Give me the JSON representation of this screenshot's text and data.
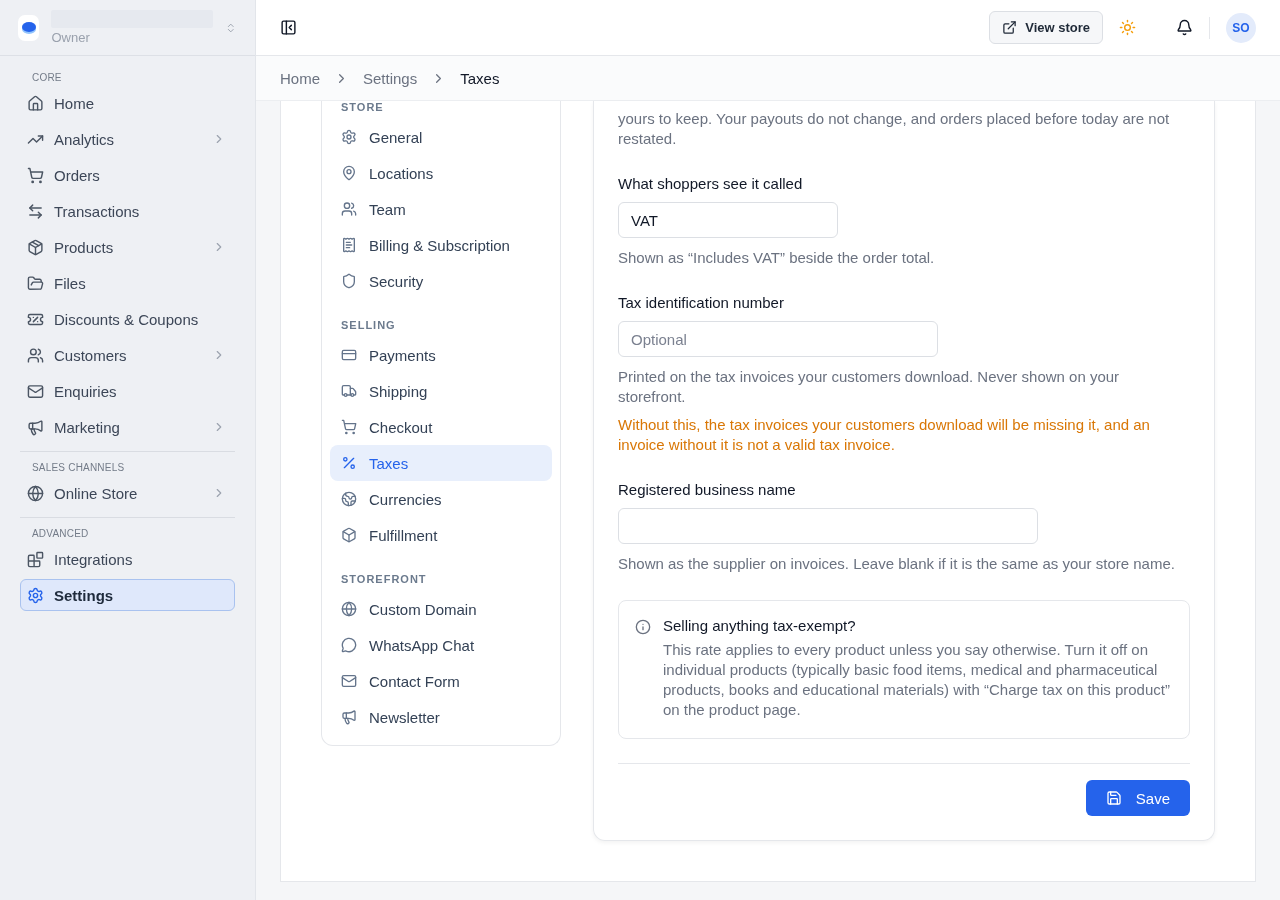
{
  "sidebar": {
    "account": {
      "role": "Owner"
    },
    "sections": [
      {
        "title": "CORE",
        "items": [
          {
            "label": "Home",
            "expandable": false,
            "selected": false
          },
          {
            "label": "Analytics",
            "expandable": true,
            "selected": false
          },
          {
            "label": "Orders",
            "expandable": false,
            "selected": false
          },
          {
            "label": "Transactions",
            "expandable": false,
            "selected": false
          },
          {
            "label": "Products",
            "expandable": true,
            "selected": false
          },
          {
            "label": "Files",
            "expandable": false,
            "selected": false
          },
          {
            "label": "Discounts & Coupons",
            "expandable": false,
            "selected": false
          },
          {
            "label": "Customers",
            "expandable": true,
            "selected": false
          },
          {
            "label": "Enquiries",
            "expandable": false,
            "selected": false
          },
          {
            "label": "Marketing",
            "expandable": true,
            "selected": false
          }
        ]
      },
      {
        "title": "SALES CHANNELS",
        "items": [
          {
            "label": "Online Store",
            "expandable": true,
            "selected": false
          }
        ]
      },
      {
        "title": "ADVANCED",
        "items": [
          {
            "label": "Integrations",
            "expandable": false,
            "selected": false
          },
          {
            "label": "Settings",
            "expandable": false,
            "selected": true
          }
        ]
      }
    ]
  },
  "header": {
    "view_store": "View store",
    "avatar": "SO"
  },
  "breadcrumb": [
    {
      "label": "Home",
      "current": false
    },
    {
      "label": "Settings",
      "current": false
    },
    {
      "label": "Taxes",
      "current": true
    }
  ],
  "settings_nav": [
    {
      "title": "STORE",
      "items": [
        {
          "label": "General",
          "selected": false
        },
        {
          "label": "Locations",
          "selected": false
        },
        {
          "label": "Team",
          "selected": false
        },
        {
          "label": "Billing & Subscription",
          "selected": false
        },
        {
          "label": "Security",
          "selected": false
        }
      ]
    },
    {
      "title": "SELLING",
      "items": [
        {
          "label": "Payments",
          "selected": false
        },
        {
          "label": "Shipping",
          "selected": false
        },
        {
          "label": "Checkout",
          "selected": false
        },
        {
          "label": "Taxes",
          "selected": true
        },
        {
          "label": "Currencies",
          "selected": false
        },
        {
          "label": "Fulfillment",
          "selected": false
        }
      ]
    },
    {
      "title": "STOREFRONT",
      "items": [
        {
          "label": "Custom Domain",
          "selected": false
        },
        {
          "label": "WhatsApp Chat",
          "selected": false
        },
        {
          "label": "Contact Form",
          "selected": false
        },
        {
          "label": "Newsletter",
          "selected": false
        }
      ]
    }
  ],
  "form": {
    "intro": "yours to keep. Your payouts do not change, and orders placed before today are not restated.",
    "fields": [
      {
        "label": "What shoppers see it called",
        "value": "VAT",
        "help": "Shown as “Includes VAT” beside the order total."
      },
      {
        "label": "Tax identification number",
        "placeholder": "Optional",
        "help": "Printed on the tax invoices your customers download. Never shown on your storefront.",
        "warning": "Without this, the tax invoices your customers download will be missing it, and an invoice without it is not a valid tax invoice."
      },
      {
        "label": "Registered business name",
        "help": "Shown as the supplier on invoices. Leave blank if it is the same as your store name."
      }
    ],
    "note": {
      "title": "Selling anything tax-exempt?",
      "text": "This rate applies to every product unless you say otherwise. Turn it off on individual products (typically basic food items, medical and pharmaceutical products, books and educational materials) with “Charge tax on this product” on the product page."
    },
    "save": "Save"
  }
}
